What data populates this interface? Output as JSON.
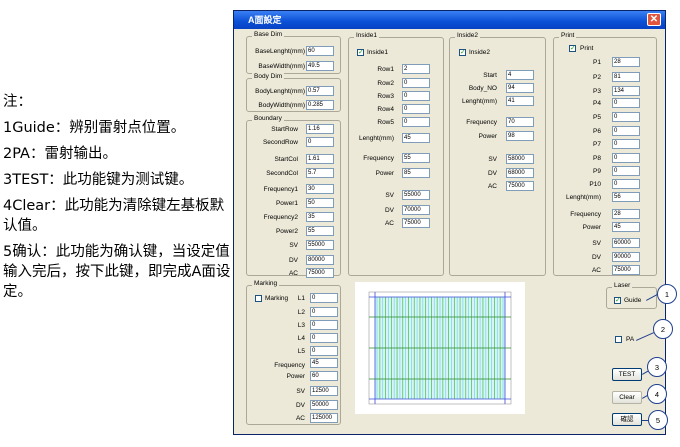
{
  "notes": [
    "注：",
    "1Guide：辨别雷射点位置。",
    "2PA：雷射输出。",
    "3TEST：此功能键为测试键。",
    "4Clear：此功能为清除键左基板默认值。",
    "5确认：此功能为确认键，当设定值输入完后，按下此键，即完成A面设定。"
  ],
  "window": {
    "title": "A面設定",
    "close_glyph": "✕"
  },
  "base_dim": {
    "label": "Base Dim",
    "fields": [
      {
        "label": "BaseLenght(mm)",
        "value": "60"
      },
      {
        "label": "BaseWidth(mm)",
        "value": "49.5"
      }
    ]
  },
  "body_dim": {
    "label": "Body Dim",
    "fields": [
      {
        "label": "BodyLenght(mm)",
        "value": "0.57"
      },
      {
        "label": "BodyWidth(mm)",
        "value": "0.285"
      }
    ]
  },
  "boundary": {
    "label": "Boundary",
    "fields": [
      {
        "label": "StartRow",
        "value": "1.16"
      },
      {
        "label": "SecondRow",
        "value": "0"
      },
      {
        "label": "StartCol",
        "value": "1.61"
      },
      {
        "label": "SecondCol",
        "value": "5.7"
      },
      {
        "label": "Frequency1",
        "value": "30"
      },
      {
        "label": "Power1",
        "value": "50"
      },
      {
        "label": "Frequency2",
        "value": "35"
      },
      {
        "label": "Power2",
        "value": "55"
      },
      {
        "label": "SV",
        "value": "55000"
      },
      {
        "label": "DV",
        "value": "80000"
      },
      {
        "label": "AC",
        "value": "75000"
      }
    ]
  },
  "inside1": {
    "label": "Inside1",
    "check_label": "Inside1",
    "fields": [
      {
        "label": "Row1",
        "value": "2"
      },
      {
        "label": "Row2",
        "value": "0"
      },
      {
        "label": "Row3",
        "value": "0"
      },
      {
        "label": "Row4",
        "value": "0"
      },
      {
        "label": "Row5",
        "value": "0"
      },
      {
        "label": "Lenght(mm)",
        "value": "45"
      },
      {
        "label": "Frequency",
        "value": "55"
      },
      {
        "label": "Power",
        "value": "85"
      },
      {
        "label": "SV",
        "value": "55000"
      },
      {
        "label": "DV",
        "value": "70000"
      },
      {
        "label": "AC",
        "value": "75000"
      }
    ]
  },
  "inside2": {
    "label": "Inside2",
    "check_label": "Inside2",
    "fields": [
      {
        "label": "Start",
        "value": "4"
      },
      {
        "label": "Body_NO",
        "value": "94"
      },
      {
        "label": "Lenght(mm)",
        "value": "41"
      },
      {
        "label": "Frequency",
        "value": "70"
      },
      {
        "label": "Power",
        "value": "98"
      },
      {
        "label": "SV",
        "value": "58000"
      },
      {
        "label": "DV",
        "value": "68000"
      },
      {
        "label": "AC",
        "value": "75000"
      }
    ]
  },
  "print": {
    "label": "Print",
    "check_label": "Print",
    "fields": [
      {
        "label": "P1",
        "value": "28"
      },
      {
        "label": "P2",
        "value": "81"
      },
      {
        "label": "P3",
        "value": "134"
      },
      {
        "label": "P4",
        "value": "0"
      },
      {
        "label": "P5",
        "value": "0"
      },
      {
        "label": "P6",
        "value": "0"
      },
      {
        "label": "P7",
        "value": "0"
      },
      {
        "label": "P8",
        "value": "0"
      },
      {
        "label": "P9",
        "value": "0"
      },
      {
        "label": "P10",
        "value": "0"
      },
      {
        "label": "Lenght(mm)",
        "value": "56"
      },
      {
        "label": "Frequency",
        "value": "28"
      },
      {
        "label": "Power",
        "value": "45"
      },
      {
        "label": "SV",
        "value": "60000"
      },
      {
        "label": "DV",
        "value": "90000"
      },
      {
        "label": "AC",
        "value": "75000"
      }
    ]
  },
  "marking": {
    "label": "Marking",
    "check_label": "Marking",
    "fields": [
      {
        "label": "L1",
        "value": "0"
      },
      {
        "label": "L2",
        "value": "0"
      },
      {
        "label": "L3",
        "value": "0"
      },
      {
        "label": "L4",
        "value": "0"
      },
      {
        "label": "L5",
        "value": "0"
      },
      {
        "label": "Frequency",
        "value": "45"
      },
      {
        "label": "Power",
        "value": "60"
      },
      {
        "label": "SV",
        "value": "12500"
      },
      {
        "label": "DV",
        "value": "50000"
      },
      {
        "label": "AC",
        "value": "125000"
      }
    ]
  },
  "laser": {
    "label": "Laser",
    "guide_label": "Guide",
    "guide_checked": true,
    "pa_label": "PA",
    "pa_checked": false
  },
  "buttons": {
    "test": "TEST",
    "clear": "Clear",
    "confirm": "確認"
  },
  "callouts": [
    "1",
    "2",
    "3",
    "4",
    "5"
  ],
  "colors": {
    "titlebar": "#0a4fd6",
    "window_bg": "#ece9d8",
    "preview_green": "#3cbf3c",
    "preview_cyan": "#6fd6e6",
    "preview_blue": "#3a4bd8",
    "callout": "#1f3f8f"
  }
}
